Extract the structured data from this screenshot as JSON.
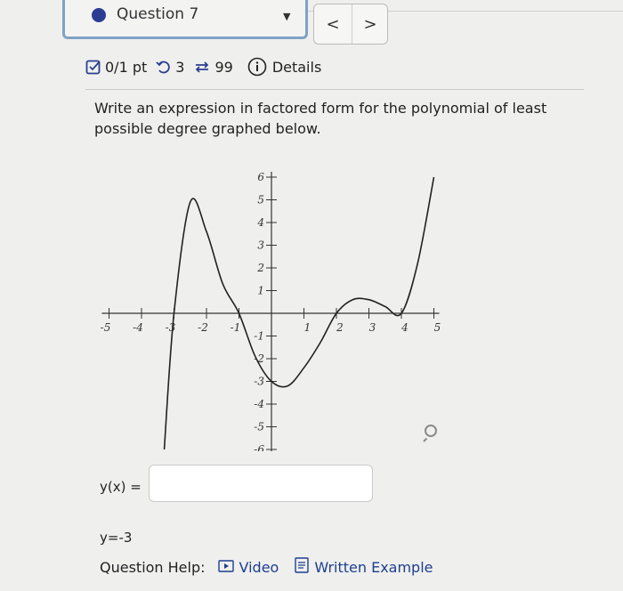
{
  "question": {
    "label": "Question 7",
    "prev_symbol": "<",
    "next_symbol": ">"
  },
  "status": {
    "score": "0/1 pt",
    "retries": "3",
    "attempts": "99",
    "details": "Details"
  },
  "prompt": "Write an expression in factored form for the polynomial of least possible degree graphed below.",
  "answer": {
    "label": "y(x) =",
    "value": ""
  },
  "note": "y=-3",
  "help": {
    "label": "Question Help:",
    "video": "Video",
    "written_example": "Written Example"
  },
  "chart_data": {
    "type": "line",
    "title": "",
    "xlabel": "",
    "ylabel": "",
    "xlim": [
      -5,
      5
    ],
    "ylim": [
      -6,
      6
    ],
    "x_ticks": [
      "-5",
      "-4",
      "-3",
      "-2",
      "-1",
      "1",
      "2",
      "3",
      "4",
      "5"
    ],
    "y_ticks": [
      "6",
      "5",
      "4",
      "3",
      "2",
      "1",
      "-1",
      "-2",
      "-3",
      "-4",
      "-5",
      "-6"
    ],
    "grid": false,
    "series": [
      {
        "x": [
          -3.3,
          -3,
          -2.5,
          -2,
          -1.5,
          -1,
          -0.5,
          0,
          0.5,
          1,
          1.5,
          2,
          2.5,
          3,
          3.5,
          4,
          4.5,
          5
        ],
        "y": [
          -6,
          0,
          4.9,
          3.6,
          1.3,
          0,
          -1.9,
          -3.0,
          -3.2,
          -2.4,
          -1.3,
          0,
          0.6,
          0.6,
          0.3,
          0,
          2.2,
          6
        ]
      }
    ]
  }
}
